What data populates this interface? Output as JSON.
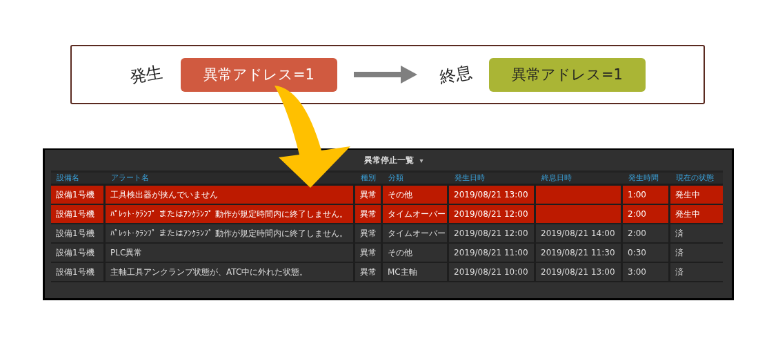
{
  "diagram": {
    "start_label": "発生",
    "start_box": "異常アドレス=1",
    "end_label": "終息",
    "end_box": "異常アドレス=1"
  },
  "screen": {
    "title": "異常停止一覧",
    "dropdown": "▾",
    "columns": [
      "設備名",
      "アラート名",
      "種別",
      "分類",
      "発生日時",
      "終息日時",
      "発生時間",
      "現在の状態"
    ],
    "rows": [
      {
        "active": true,
        "machine": "設備1号機",
        "alert": "工具検出器が挟んでいません",
        "type": "異常",
        "category": "その他",
        "start": "2019/08/21 13:00",
        "duration": "1:00",
        "status": "発生中"
      },
      {
        "active": true,
        "machine": "設備1号機",
        "alert": "ﾊﾟﾚｯﾄ･ｸﾗﾝﾌﾟ またはｱﾝｸﾗﾝﾌﾟ 動作が規定時間内に終了しません。",
        "type": "異常",
        "category": "タイムオーバー",
        "start": "2019/08/21 12:00",
        "duration": "2:00",
        "status": "発生中"
      },
      {
        "active": false,
        "machine": "設備1号機",
        "alert": "ﾊﾟﾚｯﾄ･ｸﾗﾝﾌﾟ またはｱﾝｸﾗﾝﾌﾟ 動作が規定時間内に終了しません。",
        "type": "異常",
        "category": "タイムオーバー",
        "start": "2019/08/21 12:00",
        "end": "2019/08/21 14:00",
        "duration": "2:00",
        "status": "済"
      },
      {
        "active": false,
        "machine": "設備1号機",
        "alert": "PLC異常",
        "type": "異常",
        "category": "その他",
        "start": "2019/08/21 11:00",
        "end": "2019/08/21 11:30",
        "duration": "0:30",
        "status": "済"
      },
      {
        "active": false,
        "machine": "設備1号機",
        "alert": "主軸工具アンクランプ状態が、ATC中に外れた状態。",
        "type": "異常",
        "category": "MC主軸",
        "start": "2019/08/21 10:00",
        "end": "2019/08/21 13:00",
        "duration": "3:00",
        "status": "済"
      }
    ]
  }
}
